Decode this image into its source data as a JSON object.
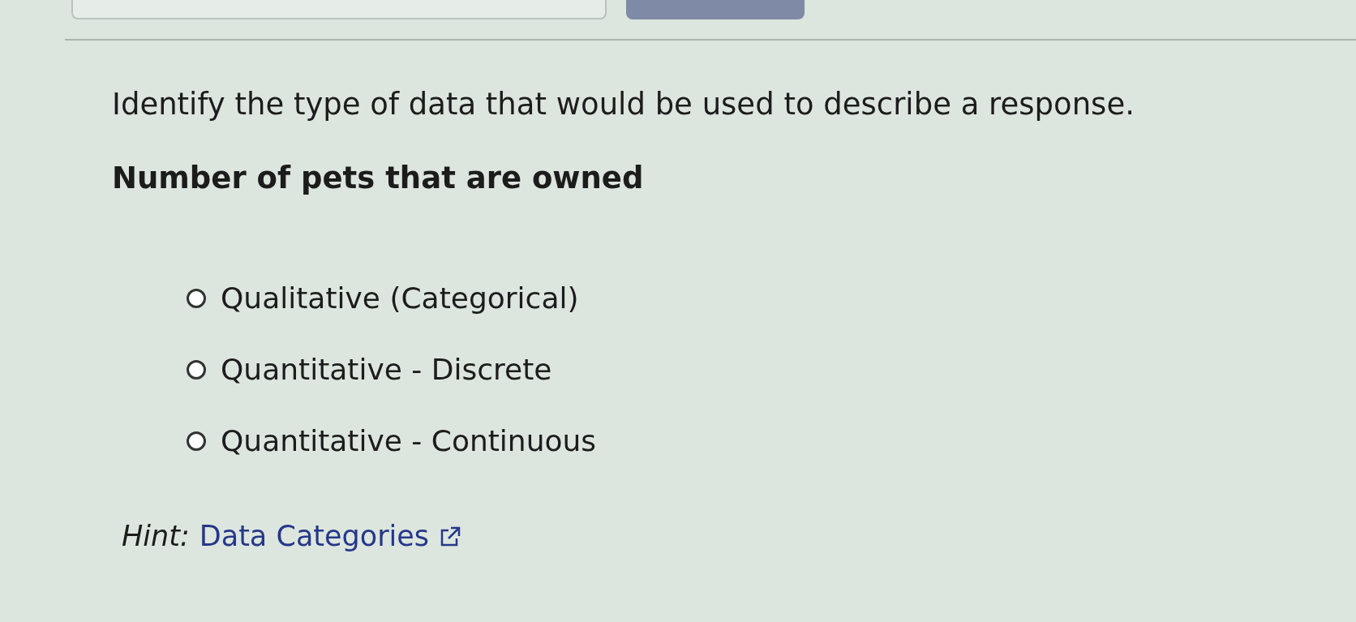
{
  "question": "Identify the type of data that would be used to describe a response.",
  "prompt": "Number of pets that are owned",
  "options": [
    {
      "label": "Qualitative (Categorical)",
      "selected": false
    },
    {
      "label": "Quantitative - Discrete",
      "selected": false
    },
    {
      "label": "Quantitative - Continuous",
      "selected": false
    }
  ],
  "hint": {
    "label": "Hint:",
    "link": "Data Categories"
  }
}
